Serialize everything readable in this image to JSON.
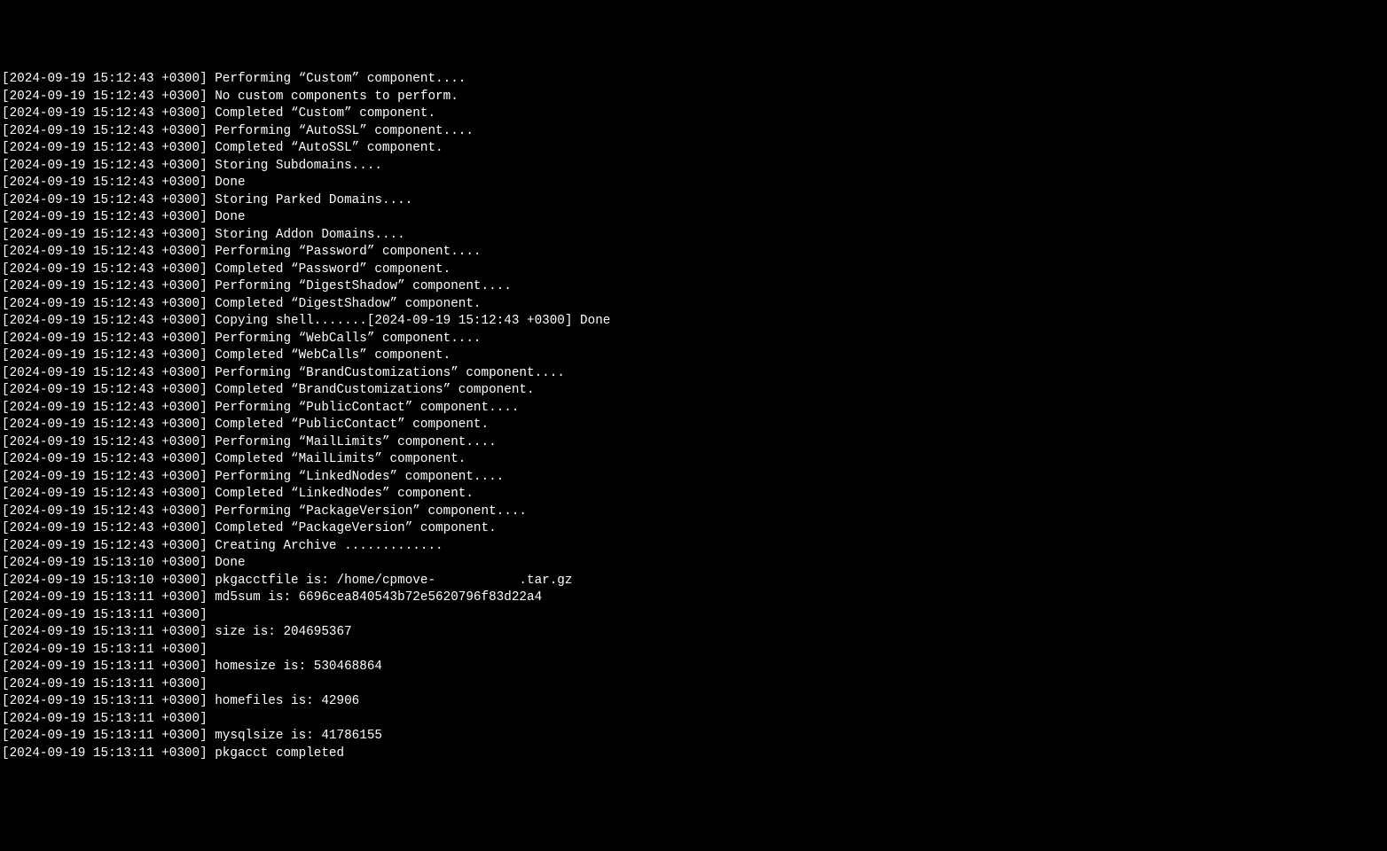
{
  "log_lines": [
    "[2024-09-19 15:12:43 +0300] Performing “Custom” component....",
    "[2024-09-19 15:12:43 +0300] No custom components to perform.",
    "[2024-09-19 15:12:43 +0300] Completed “Custom” component.",
    "[2024-09-19 15:12:43 +0300] Performing “AutoSSL” component....",
    "[2024-09-19 15:12:43 +0300] Completed “AutoSSL” component.",
    "[2024-09-19 15:12:43 +0300] Storing Subdomains....",
    "[2024-09-19 15:12:43 +0300] Done",
    "[2024-09-19 15:12:43 +0300] Storing Parked Domains....",
    "[2024-09-19 15:12:43 +0300] Done",
    "[2024-09-19 15:12:43 +0300] Storing Addon Domains....",
    "[2024-09-19 15:12:43 +0300] Performing “Password” component....",
    "[2024-09-19 15:12:43 +0300] Completed “Password” component.",
    "[2024-09-19 15:12:43 +0300] Performing “DigestShadow” component....",
    "[2024-09-19 15:12:43 +0300] Completed “DigestShadow” component.",
    "[2024-09-19 15:12:43 +0300] Copying shell.......[2024-09-19 15:12:43 +0300] Done",
    "[2024-09-19 15:12:43 +0300] Performing “WebCalls” component....",
    "[2024-09-19 15:12:43 +0300] Completed “WebCalls” component.",
    "[2024-09-19 15:12:43 +0300] Performing “BrandCustomizations” component....",
    "[2024-09-19 15:12:43 +0300] Completed “BrandCustomizations” component.",
    "[2024-09-19 15:12:43 +0300] Performing “PublicContact” component....",
    "[2024-09-19 15:12:43 +0300] Completed “PublicContact” component.",
    "[2024-09-19 15:12:43 +0300] Performing “MailLimits” component....",
    "[2024-09-19 15:12:43 +0300] Completed “MailLimits” component.",
    "[2024-09-19 15:12:43 +0300] Performing “LinkedNodes” component....",
    "[2024-09-19 15:12:43 +0300] Completed “LinkedNodes” component.",
    "[2024-09-19 15:12:43 +0300] Performing “PackageVersion” component....",
    "[2024-09-19 15:12:43 +0300] Completed “PackageVersion” component.",
    "[2024-09-19 15:12:43 +0300] Creating Archive .............",
    "[2024-09-19 15:13:10 +0300] Done",
    "[2024-09-19 15:13:10 +0300] pkgacctfile is: /home/cpmove-           .tar.gz",
    "[2024-09-19 15:13:11 +0300] md5sum is: 6696cea840543b72e5620796f83d22a4",
    "[2024-09-19 15:13:11 +0300] ",
    "[2024-09-19 15:13:11 +0300] size is: 204695367",
    "[2024-09-19 15:13:11 +0300] ",
    "[2024-09-19 15:13:11 +0300] homesize is: 530468864",
    "[2024-09-19 15:13:11 +0300] ",
    "[2024-09-19 15:13:11 +0300] homefiles is: 42906",
    "[2024-09-19 15:13:11 +0300] ",
    "[2024-09-19 15:13:11 +0300] mysqlsize is: 41786155",
    "[2024-09-19 15:13:11 +0300] pkgacct completed"
  ]
}
